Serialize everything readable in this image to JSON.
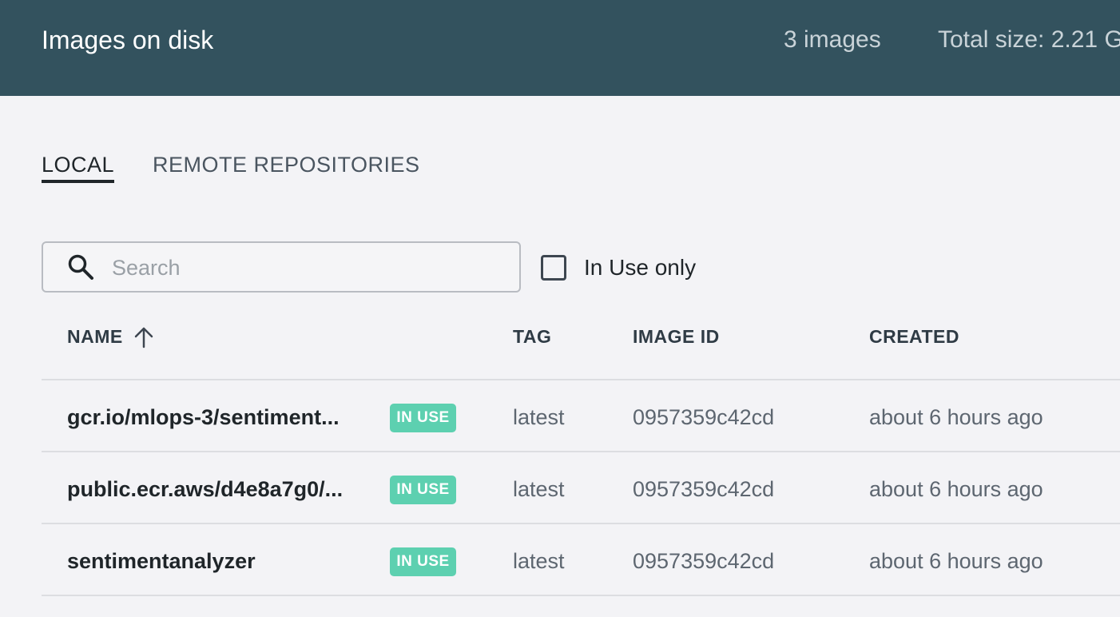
{
  "header": {
    "title": "Images on disk",
    "image_count": "3 images",
    "total_size": "Total size: 2.21 G"
  },
  "tabs": [
    {
      "label": "LOCAL",
      "active": true
    },
    {
      "label": "REMOTE REPOSITORIES",
      "active": false
    }
  ],
  "search": {
    "placeholder": "Search",
    "value": "",
    "icon": "search-icon"
  },
  "filter": {
    "label": "In Use only",
    "checked": false
  },
  "table": {
    "columns": [
      {
        "label": "NAME",
        "sort": "ascending",
        "sort_icon": "arrow-up-icon"
      },
      {
        "label": "TAG"
      },
      {
        "label": "IMAGE ID"
      },
      {
        "label": "CREATED"
      }
    ],
    "rows": [
      {
        "name": "gcr.io/mlops-3/sentiment...",
        "badge": "IN USE",
        "tag": "latest",
        "image_id": "0957359c42cd",
        "created": "about 6 hours ago"
      },
      {
        "name": "public.ecr.aws/d4e8a7g0/...",
        "badge": "IN USE",
        "tag": "latest",
        "image_id": "0957359c42cd",
        "created": "about 6 hours ago"
      },
      {
        "name": "sentimentanalyzer",
        "badge": "IN USE",
        "tag": "latest",
        "image_id": "0957359c42cd",
        "created": "about 6 hours ago"
      }
    ]
  },
  "colors": {
    "header_bg": "#33525e",
    "page_bg": "#f3f3f6",
    "badge_bg": "#5dd0b0"
  }
}
